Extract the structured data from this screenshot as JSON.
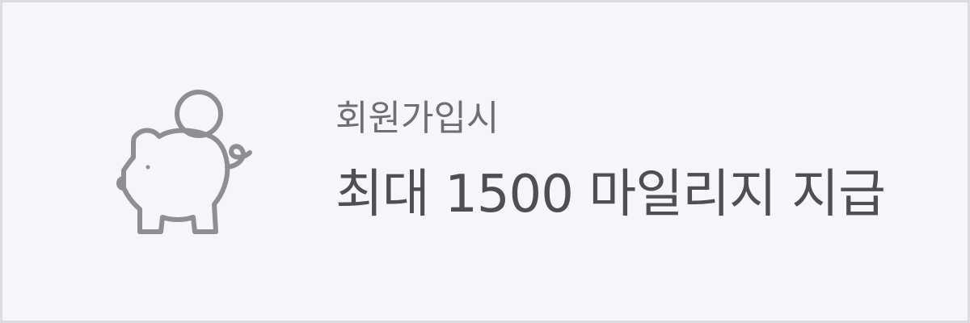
{
  "promo": {
    "icon": "piggy-bank-coin-icon",
    "subtitle": "회원가입시",
    "title": "최대 1500 마일리지 지급"
  },
  "colors": {
    "background": "#f6f6f8",
    "border": "#dcdcdf",
    "icon": "#8f8f93",
    "subtitle": "#6f6f73",
    "title": "#4f4f53"
  }
}
